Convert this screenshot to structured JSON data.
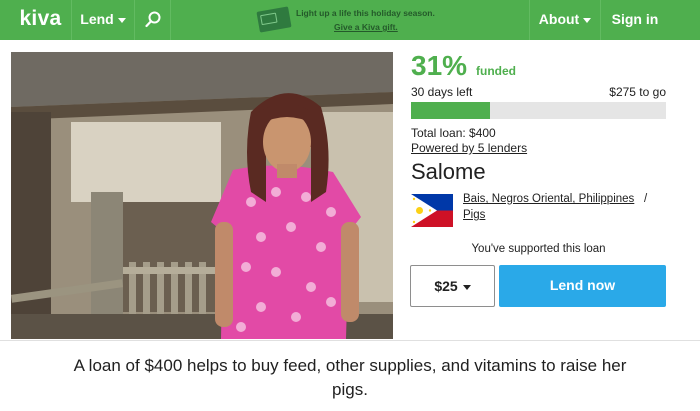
{
  "header": {
    "logo": "kiva",
    "lend_label": "Lend",
    "promo_line1": "Light up a life this holiday season.",
    "promo_line2": "Give a Kiva gift.",
    "about_label": "About",
    "signin_label": "Sign in",
    "color": "#4faf4e"
  },
  "loan": {
    "percent_funded": "31%",
    "funded_label": "funded",
    "funded_fraction": 0.31,
    "days_left": "30 days left",
    "to_go": "$275 to go",
    "total_loan": "Total loan: $400",
    "lenders": "Powered by 5 lenders",
    "borrower_name": "Salome",
    "location": "Bais, Negros Oriental, Philippines",
    "location_separator": "/",
    "sector": "Pigs",
    "supported_text": "You've supported this loan",
    "amount": "$25",
    "lend_button": "Lend now",
    "description": "A loan of $400 helps to buy feed, other supplies, and vitamins to raise her pigs."
  },
  "icons": {
    "search": "search-icon",
    "caret": "chevron-down-icon",
    "flag": "philippines-flag-icon",
    "gift_card": "gift-card-icon"
  },
  "colors": {
    "brand_green": "#4faf4e",
    "lend_blue": "#2aa9e8",
    "progress_track": "#e5e5e5"
  }
}
